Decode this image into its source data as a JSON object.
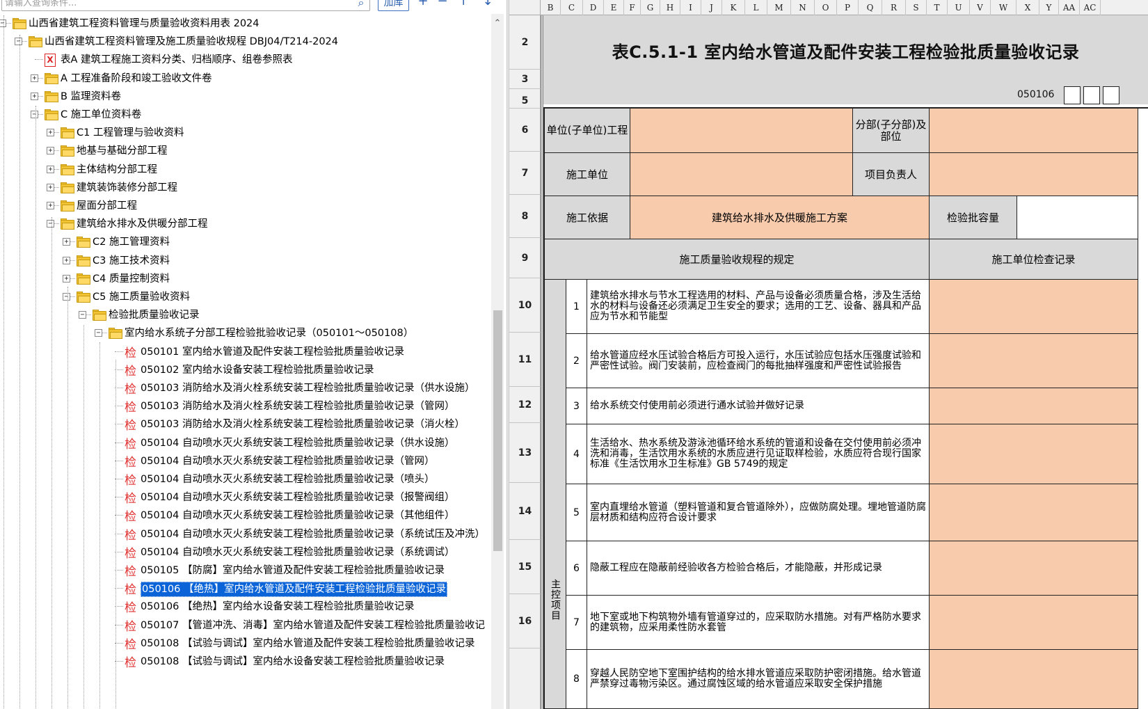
{
  "search": {
    "placeholder": "请输入查询条件...",
    "add_button": "加库",
    "add_icon": "+",
    "remove_icon": "−",
    "up_icon": "↑",
    "down_icon": "↓",
    "search_icon": "⌕"
  },
  "tree": [
    {
      "label": "山西省建筑工程资料管理与质量验收资料用表 2024",
      "type": "folder",
      "expander": "−"
    },
    {
      "label": "山西省建筑工程资料管理及施工质量验收规程 DBJ04/T214-2024",
      "type": "folder",
      "expander": "−"
    },
    {
      "label": "表A 建筑工程施工资料分类、归档顺序、组卷参照表",
      "type": "excel",
      "expander": ""
    },
    {
      "label": "A 工程准备阶段和竣工验收文件卷",
      "type": "folder",
      "expander": "+"
    },
    {
      "label": "B 监理资料卷",
      "type": "folder",
      "expander": "+"
    },
    {
      "label": "C 施工单位资料卷",
      "type": "folder",
      "expander": "−"
    },
    {
      "label": "C1 工程管理与验收资料",
      "type": "folder",
      "expander": "+"
    },
    {
      "label": "地基与基础分部工程",
      "type": "folder",
      "expander": "+"
    },
    {
      "label": "主体结构分部工程",
      "type": "folder",
      "expander": "+"
    },
    {
      "label": "建筑装饰装修分部工程",
      "type": "folder",
      "expander": "+"
    },
    {
      "label": "屋面分部工程",
      "type": "folder",
      "expander": "+"
    },
    {
      "label": "建筑给水排水及供暖分部工程",
      "type": "folder",
      "expander": "−"
    },
    {
      "label": "C2 施工管理资料",
      "type": "folder",
      "expander": "+"
    },
    {
      "label": "C3 施工技术资料",
      "type": "folder",
      "expander": "+"
    },
    {
      "label": "C4 质量控制资料",
      "type": "folder",
      "expander": "+"
    },
    {
      "label": "C5 施工质量验收资料",
      "type": "folder",
      "expander": "−"
    },
    {
      "label": "检验批质量验收记录",
      "type": "folder",
      "expander": "−"
    },
    {
      "label": "室内给水系统子分部工程检验批验收记录（050101～050108）",
      "type": "folder",
      "expander": "−"
    },
    {
      "label": "050101 室内给水管道及配件安装工程检验批质量验收记录",
      "type": "jian",
      "expander": ""
    },
    {
      "label": "050102 室内给水设备安装工程检验批质量验收记录",
      "type": "jian",
      "expander": ""
    },
    {
      "label": "050103 消防给水及消火栓系统安装工程检验批质量验收记录（供水设施）",
      "type": "jian",
      "expander": ""
    },
    {
      "label": "050103 消防给水及消火栓系统安装工程检验批质量验收记录（管网）",
      "type": "jian",
      "expander": ""
    },
    {
      "label": "050103 消防给水及消火栓系统安装工程检验批质量验收记录（消火栓）",
      "type": "jian",
      "expander": ""
    },
    {
      "label": "050104 自动喷水灭火系统安装工程检验批质量验收记录（供水设施）",
      "type": "jian",
      "expander": ""
    },
    {
      "label": "050104 自动喷水灭火系统安装工程检验批质量验收记录（管网）",
      "type": "jian",
      "expander": ""
    },
    {
      "label": "050104 自动喷水灭火系统安装工程检验批质量验收记录（喷头）",
      "type": "jian",
      "expander": ""
    },
    {
      "label": "050104 自动喷水灭火系统安装工程检验批质量验收记录（报警阀组）",
      "type": "jian",
      "expander": ""
    },
    {
      "label": "050104 自动喷水灭火系统安装工程检验批质量验收记录（其他组件）",
      "type": "jian",
      "expander": ""
    },
    {
      "label": "050104 自动喷水灭火系统安装工程检验批质量验收记录（系统试压及冲洗）",
      "type": "jian",
      "expander": ""
    },
    {
      "label": "050104 自动喷水灭火系统安装工程检验批质量验收记录（系统调试）",
      "type": "jian",
      "expander": ""
    },
    {
      "label": "050105 【防腐】室内给水管道及配件安装工程检验批质量验收记录",
      "type": "jian",
      "expander": ""
    },
    {
      "label": "050106 【绝热】室内给水管道及配件安装工程检验批质量验收记录",
      "type": "jian",
      "expander": "",
      "selected": true
    },
    {
      "label": "050106 【绝热】室内给水设备安装工程检验批质量验收记录",
      "type": "jian",
      "expander": ""
    },
    {
      "label": "050107 【管道冲洗、消毒】室内给水管道及配件安装工程检验批质量验收记",
      "type": "jian",
      "expander": ""
    },
    {
      "label": "050108 【试验与调试】室内给水管道及配件安装工程检验批质量验收记录",
      "type": "jian",
      "expander": ""
    },
    {
      "label": "050108 【试验与调试】室内给水设备安装工程检验批质量验收记录",
      "type": "jian",
      "expander": ""
    }
  ],
  "jian_glyph": "检",
  "excel_glyph": "X",
  "sheet": {
    "columns": [
      "B",
      "C",
      "D",
      "E",
      "F",
      "G",
      "H",
      "I",
      "J",
      "K",
      "L",
      "M",
      "N",
      "O",
      "P",
      "Q",
      "R",
      "S",
      "T",
      "U",
      "V",
      "W",
      "X",
      "Y",
      "AA",
      "AC"
    ],
    "rows": [
      "2",
      "3",
      "5",
      "6",
      "7",
      "8",
      "9",
      "10",
      "11",
      "12",
      "13",
      "14",
      "15",
      "16"
    ],
    "title": "表C.5.1-1 室内给水管道及配件安装工程检验批质量验收记录",
    "code": "050106",
    "labels": {
      "unit_project": "单位(子单位)工程",
      "sub_project": "分部(子分部)及部位",
      "contractor": "施工单位",
      "project_manager": "项目负责人",
      "basis": "施工依据",
      "basis_value": "建筑给水排水及供暖施工方案",
      "batch_capacity": "检验批容量",
      "spec_header": "施工质量验收规程的规定",
      "check_header": "施工单位检查记录",
      "main_items": "主控项目"
    },
    "items": [
      {
        "no": "1",
        "text": "建筑给水排水与节水工程选用的材料、产品与设备必须质量合格，涉及生活给水的材料与设备还必须满足卫生安全的要求；选用的工艺、设备、器具和产品应为节水和节能型"
      },
      {
        "no": "2",
        "text": "给水管道应经水压试验合格后方可投入运行，水压试验应包括水压强度试验和严密性试验。阀门安装前，应检查阀门的每批抽样强度和严密性试验报告"
      },
      {
        "no": "3",
        "text": "给水系统交付使用前必须进行通水试验并做好记录"
      },
      {
        "no": "4",
        "text": "生活给水、热水系统及游泳池循环给水系统的管道和设备在交付使用前必须冲洗和消毒，生活饮用水系统的水质应进行见证取样检验，水质应符合现行国家标准《生活饮用水卫生标准》GB 5749的规定"
      },
      {
        "no": "5",
        "text": "室内直埋给水管道（塑料管道和复合管道除外），应做防腐处理。埋地管道防腐层材质和结构应符合设计要求"
      },
      {
        "no": "6",
        "text": "隐蔽工程应在隐蔽前经验收各方检验合格后，才能隐蔽，并形成记录"
      },
      {
        "no": "7",
        "text": "地下室或地下构筑物外墙有管道穿过的，应采取防水措施。对有严格防水要求的建筑物，应采用柔性防水套管"
      },
      {
        "no": "8",
        "text": "穿越人民防空地下室围护结构的给水排水管道应采取防护密闭措施。给水管道严禁穿过毒物污染区。通过腐蚀区域的给水管道应采取安全保护措施"
      }
    ]
  },
  "colors": {
    "peach": "#f8cbad",
    "header_gray": "#d9d9d9",
    "selection": "#0a64d8",
    "check_red": "#e03030"
  }
}
